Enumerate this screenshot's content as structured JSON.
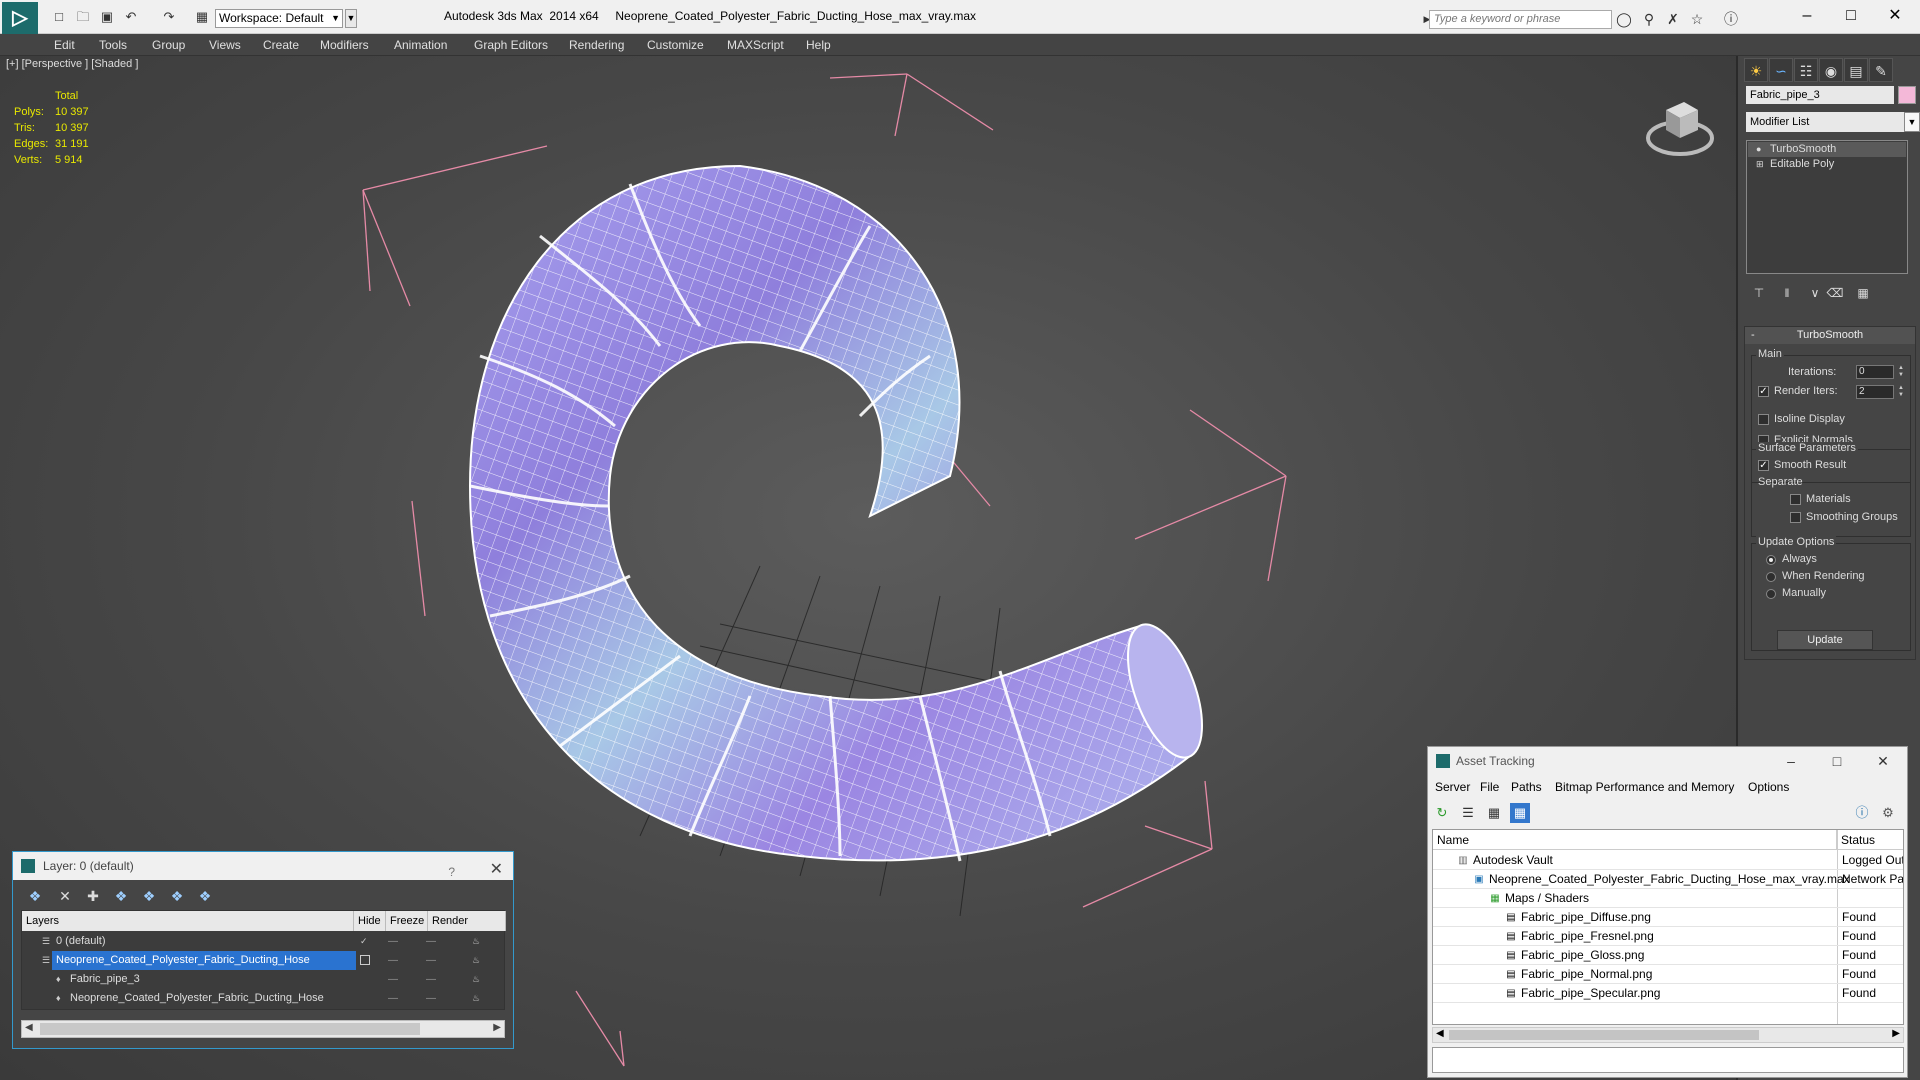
{
  "title_bar": {
    "workspace": "Workspace: Default",
    "app_title": "Autodesk 3ds Max  2014 x64     Neoprene_Coated_Polyester_Fabric_Ducting_Hose_max_vray.max",
    "search_placeholder": "Type a keyword or phrase"
  },
  "menu": [
    "Edit",
    "Tools",
    "Group",
    "Views",
    "Create",
    "Modifiers",
    "Animation",
    "Graph Editors",
    "Rendering",
    "Customize",
    "MAXScript",
    "Help"
  ],
  "viewport": {
    "label": "[+] [Perspective ] [Shaded ]",
    "stats": {
      "header": "Total",
      "rows": [
        {
          "label": "Polys:",
          "value": "10 397"
        },
        {
          "label": "Tris:",
          "value": "10 397"
        },
        {
          "label": "Edges:",
          "value": "31 191"
        },
        {
          "label": "Verts:",
          "value": "5 914"
        }
      ]
    }
  },
  "command_panel": {
    "object_name": "Fabric_pipe_3",
    "object_color": "#f4b8d8",
    "modifier_list": "Modifier List",
    "stack": [
      "TurboSmooth",
      "Editable Poly"
    ],
    "rollout_title": "TurboSmooth",
    "main_group": "Main",
    "iterations_label": "Iterations:",
    "iterations_value": "0",
    "render_iters_label": "Render Iters:",
    "render_iters_value": "2",
    "isoline_display": "Isoline Display",
    "explicit_normals": "Explicit Normals",
    "surface_params": "Surface Parameters",
    "smooth_result": "Smooth Result",
    "separate": "Separate",
    "materials": "Materials",
    "smoothing_groups": "Smoothing Groups",
    "update_options": "Update Options",
    "always": "Always",
    "when_rendering": "When Rendering",
    "manually": "Manually",
    "update_button": "Update"
  },
  "layer_dialog": {
    "title": "Layer: 0 (default)",
    "help": "?",
    "columns": {
      "layers": "Layers",
      "hide": "Hide",
      "freeze": "Freeze",
      "render": "Render"
    },
    "rows": [
      {
        "name": "0 (default)"
      },
      {
        "name": "Neoprene_Coated_Polyester_Fabric_Ducting_Hose"
      },
      {
        "name": "Fabric_pipe_3"
      },
      {
        "name": "Neoprene_Coated_Polyester_Fabric_Ducting_Hose"
      }
    ]
  },
  "asset_tracking": {
    "title": "Asset Tracking",
    "menu": [
      "Server",
      "File",
      "Paths",
      "Bitmap Performance and Memory",
      "Options"
    ],
    "columns": {
      "name": "Name",
      "status": "Status"
    },
    "rows": [
      {
        "name": "Autodesk Vault",
        "status": "Logged Out"
      },
      {
        "name": "Neoprene_Coated_Polyester_Fabric_Ducting_Hose_max_vray.max",
        "status": "Network Pat"
      },
      {
        "name": "Maps / Shaders",
        "status": ""
      },
      {
        "name": "Fabric_pipe_Diffuse.png",
        "status": "Found"
      },
      {
        "name": "Fabric_pipe_Fresnel.png",
        "status": "Found"
      },
      {
        "name": "Fabric_pipe_Gloss.png",
        "status": "Found"
      },
      {
        "name": "Fabric_pipe_Normal.png",
        "status": "Found"
      },
      {
        "name": "Fabric_pipe_Specular.png",
        "status": "Found"
      }
    ]
  }
}
